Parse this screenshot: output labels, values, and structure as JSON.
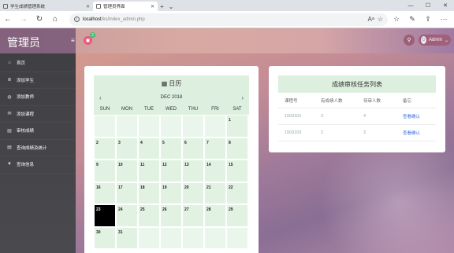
{
  "browser": {
    "tabs": [
      {
        "label": "学生成绩管理系统",
        "active": false
      },
      {
        "label": "管理员界面",
        "active": true
      }
    ],
    "new_tab_symbol": "+",
    "tab_menu_symbol": "⌄",
    "url_host": "localhost",
    "url_path": "/ks/index_admin.php"
  },
  "app": {
    "brand": "管理员",
    "notification_count": "2",
    "user_name": "Admin",
    "accent_color": "#e8577f"
  },
  "sidebar": {
    "items": [
      {
        "label": "首页",
        "icon": "home-icon"
      },
      {
        "label": "添加学生",
        "icon": "list-icon"
      },
      {
        "label": "添加教师",
        "icon": "globe-icon"
      },
      {
        "label": "添加课程",
        "icon": "envelope-icon"
      },
      {
        "label": "审核成绩",
        "icon": "bar-chart-icon"
      },
      {
        "label": "查询成绩及统计",
        "icon": "bar-chart-icon"
      },
      {
        "label": "查询信息",
        "icon": "filter-icon"
      }
    ]
  },
  "calendar": {
    "title": "日历",
    "month": "DEC 2018",
    "prev_symbol": "‹",
    "next_symbol": "›",
    "days_of_week": [
      "SUN",
      "MON",
      "TUE",
      "WED",
      "THU",
      "FRI",
      "SAT"
    ],
    "leading_blanks": 6,
    "days": [
      "1",
      "2",
      "3",
      "4",
      "5",
      "6",
      "7",
      "8",
      "9",
      "10",
      "11",
      "12",
      "13",
      "14",
      "15",
      "16",
      "17",
      "18",
      "19",
      "20",
      "21",
      "22",
      "23",
      "24",
      "25",
      "26",
      "27",
      "28",
      "29",
      "30",
      "31"
    ],
    "today": "23",
    "trailing_blanks": 5
  },
  "tasks": {
    "title": "成绩审核任务列表",
    "columns": [
      "课程号",
      "有成绩人数",
      "待审人数",
      "备忘"
    ],
    "rows": [
      {
        "course": "1503101",
        "with_grades": "3",
        "pending": "4",
        "action": "查看确认"
      },
      {
        "course": "1503103",
        "with_grades": "2",
        "pending": "3",
        "action": "查看确认"
      }
    ]
  }
}
